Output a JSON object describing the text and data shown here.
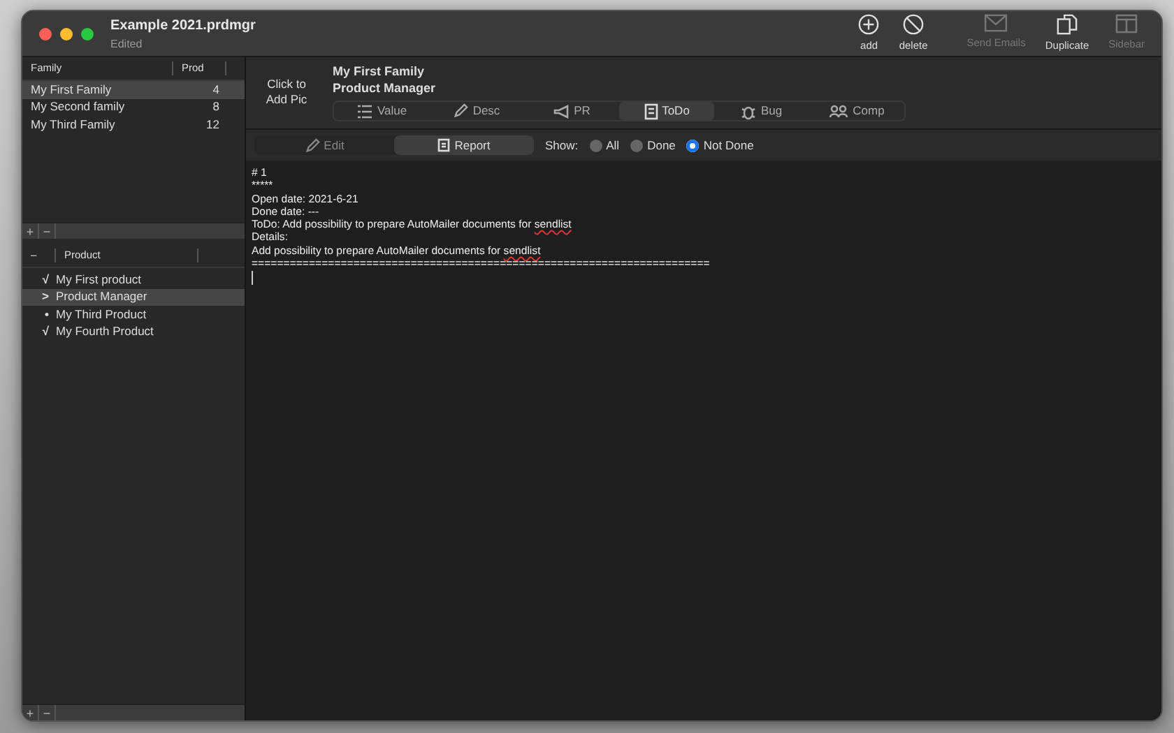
{
  "window": {
    "title": "Example 2021.prdmgr",
    "subtitle": "Edited"
  },
  "toolbar": [
    {
      "label": "add",
      "disabled": false
    },
    {
      "label": "delete",
      "disabled": false
    },
    {
      "label": "Send Emails",
      "disabled": true
    },
    {
      "label": "Duplicate",
      "disabled": false
    },
    {
      "label": "Sidebar",
      "disabled": true
    }
  ],
  "families": {
    "columns": [
      "Family",
      "Prod"
    ],
    "rows": [
      {
        "name": "My First Family",
        "count": "4",
        "selected": true
      },
      {
        "name": "My Second family",
        "count": "8",
        "selected": false
      },
      {
        "name": "My Third Family",
        "count": "12",
        "selected": false
      }
    ],
    "buttons": [
      "+",
      "−"
    ]
  },
  "products": {
    "columns": [
      "–",
      "Product"
    ],
    "rows": [
      {
        "mark": "√",
        "name": "My First product",
        "selected": false
      },
      {
        "mark": ">",
        "name": "Product Manager",
        "selected": true
      },
      {
        "mark": "•",
        "name": "My Third Product",
        "selected": false
      },
      {
        "mark": "√",
        "name": "My Fourth Product",
        "selected": false
      }
    ],
    "buttons": [
      "+",
      "−"
    ]
  },
  "header": {
    "pic_label": "Click to Add Pic",
    "family": "My First Family",
    "product": "Product Manager"
  },
  "tabs": [
    {
      "label": "Value",
      "selected": false
    },
    {
      "label": "Desc",
      "selected": false
    },
    {
      "label": "PR",
      "selected": false
    },
    {
      "label": "ToDo",
      "selected": true
    },
    {
      "label": "Bug",
      "selected": false
    },
    {
      "label": "Comp",
      "selected": false
    }
  ],
  "modes": [
    {
      "label": "Edit",
      "selected": false
    },
    {
      "label": "Report",
      "selected": true
    }
  ],
  "show": {
    "label": "Show:",
    "options": [
      {
        "label": "All",
        "selected": false
      },
      {
        "label": "Done",
        "selected": false
      },
      {
        "label": "Not Done",
        "selected": true
      }
    ]
  },
  "report": [
    [
      {
        "text": "# 1"
      }
    ],
    [
      {
        "text": "*****"
      }
    ],
    [
      {
        "text": "Open date: 2021-6-21"
      }
    ],
    [
      {
        "text": "Done date: ---"
      }
    ],
    [
      {
        "text": "ToDo: Add possibility to prepare AutoMailer documents for "
      },
      {
        "text": "sendlist",
        "misspelled": true
      }
    ],
    [
      {
        "text": "Details:"
      }
    ],
    [
      {
        "text": "Add possibility to prepare AutoMailer documents for "
      },
      {
        "text": "sendlist",
        "misspelled": true
      }
    ],
    [
      {
        "text": "========================================================================"
      }
    ]
  ]
}
